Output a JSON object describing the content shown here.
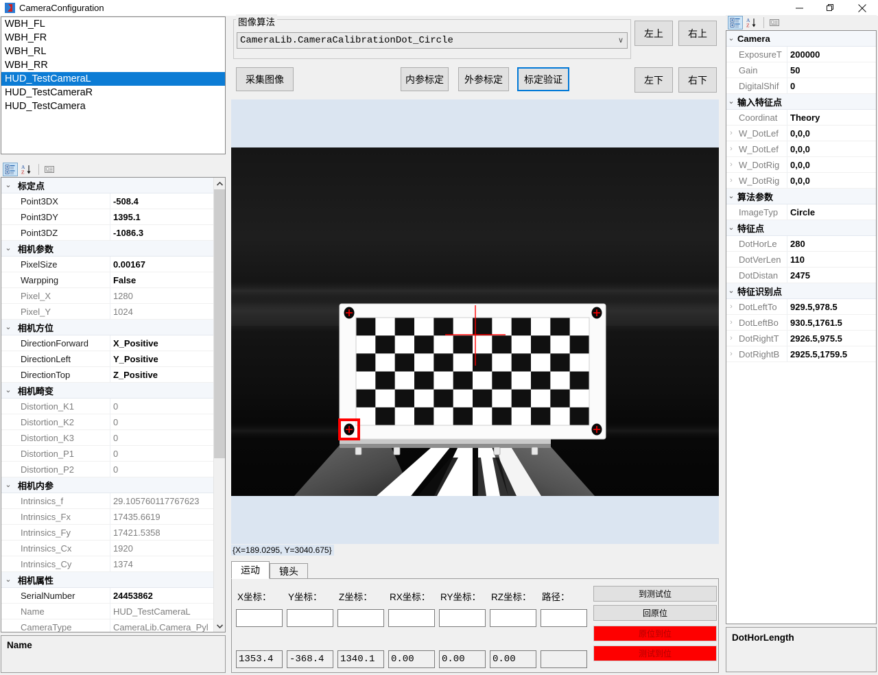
{
  "window": {
    "title": "CameraConfiguration",
    "icon": "app-icon",
    "minimize": "—",
    "maximize": "❐",
    "close": "✕"
  },
  "camera_list": {
    "items": [
      {
        "label": "WBH_FL",
        "selected": false
      },
      {
        "label": "WBH_FR",
        "selected": false
      },
      {
        "label": "WBH_RL",
        "selected": false
      },
      {
        "label": "WBH_RR",
        "selected": false
      },
      {
        "label": "HUD_TestCameraL",
        "selected": true
      },
      {
        "label": "HUD_TestCameraR",
        "selected": false
      },
      {
        "label": "HUD_TestCamera",
        "selected": false
      }
    ],
    "selection_color": "#0c7cd5"
  },
  "left_grid": {
    "toolbar": {
      "categorized": "categorized-view-icon",
      "alphabetical": "alphabetical-sort-icon",
      "property_pages": "property-pages-icon"
    },
    "rows": [
      {
        "kind": "category",
        "expander": "⌄",
        "name": "标定点",
        "value": ""
      },
      {
        "kind": "prop",
        "name": "Point3DX",
        "value": "-508.4",
        "bold": true,
        "name_dark": true
      },
      {
        "kind": "prop",
        "name": "Point3DY",
        "value": "1395.1",
        "bold": true,
        "name_dark": true
      },
      {
        "kind": "prop",
        "name": "Point3DZ",
        "value": "-1086.3",
        "bold": true,
        "name_dark": true
      },
      {
        "kind": "category",
        "expander": "⌄",
        "name": "相机参数",
        "value": ""
      },
      {
        "kind": "prop",
        "name": "PixelSize",
        "value": "0.00167",
        "bold": true,
        "name_dark": true
      },
      {
        "kind": "prop",
        "name": "Warpping",
        "value": "False",
        "bold": true,
        "name_dark": true
      },
      {
        "kind": "prop",
        "name": "Pixel_X",
        "value": "1280",
        "bold": false,
        "name_dark": false
      },
      {
        "kind": "prop",
        "name": "Pixel_Y",
        "value": "1024",
        "bold": false,
        "name_dark": false
      },
      {
        "kind": "category",
        "expander": "⌄",
        "name": "相机方位",
        "value": ""
      },
      {
        "kind": "prop",
        "name": "DirectionForward",
        "value": "X_Positive",
        "bold": true,
        "name_dark": true
      },
      {
        "kind": "prop",
        "name": "DirectionLeft",
        "value": "Y_Positive",
        "bold": true,
        "name_dark": true
      },
      {
        "kind": "prop",
        "name": "DirectionTop",
        "value": "Z_Positive",
        "bold": true,
        "name_dark": true
      },
      {
        "kind": "category",
        "expander": "⌄",
        "name": "相机畸变",
        "value": ""
      },
      {
        "kind": "prop",
        "name": "Distortion_K1",
        "value": "0",
        "bold": false,
        "name_dark": false
      },
      {
        "kind": "prop",
        "name": "Distortion_K2",
        "value": "0",
        "bold": false,
        "name_dark": false
      },
      {
        "kind": "prop",
        "name": "Distortion_K3",
        "value": "0",
        "bold": false,
        "name_dark": false
      },
      {
        "kind": "prop",
        "name": "Distortion_P1",
        "value": "0",
        "bold": false,
        "name_dark": false
      },
      {
        "kind": "prop",
        "name": "Distortion_P2",
        "value": "0",
        "bold": false,
        "name_dark": false
      },
      {
        "kind": "category",
        "expander": "⌄",
        "name": "相机内参",
        "value": ""
      },
      {
        "kind": "prop",
        "name": "Intrinsics_f",
        "value": "29.105760117767623",
        "bold": false,
        "name_dark": false
      },
      {
        "kind": "prop",
        "name": "Intrinsics_Fx",
        "value": "17435.6619",
        "bold": false,
        "name_dark": false
      },
      {
        "kind": "prop",
        "name": "Intrinsics_Fy",
        "value": "17421.5358",
        "bold": false,
        "name_dark": false
      },
      {
        "kind": "prop",
        "name": "Intrinsics_Cx",
        "value": "1920",
        "bold": false,
        "name_dark": false
      },
      {
        "kind": "prop",
        "name": "Intrinsics_Cy",
        "value": "1374",
        "bold": false,
        "name_dark": false
      },
      {
        "kind": "category",
        "expander": "⌄",
        "name": "相机属性",
        "value": ""
      },
      {
        "kind": "prop",
        "name": "SerialNumber",
        "value": "24453862",
        "bold": true,
        "name_dark": true
      },
      {
        "kind": "prop",
        "name": "Name",
        "value": "HUD_TestCameraL",
        "bold": false,
        "name_dark": false
      },
      {
        "kind": "prop",
        "name": "CameraType",
        "value": "CameraLib.Camera_Pyl",
        "bold": false,
        "name_dark": false
      }
    ],
    "description": {
      "title": "Name",
      "text": ""
    }
  },
  "algorithm": {
    "group_label": "图像算法",
    "combo_value": "CameraLib.CameraCalibrationDot_Circle",
    "combo_arrow": "∨"
  },
  "buttons": {
    "capture": "采集图像",
    "intrinsic": "内参标定",
    "extrinsic": "外参标定",
    "verify": "标定验证",
    "left_top": "左上",
    "right_top": "右上",
    "left_bottom": "左下",
    "right_bottom": "右下",
    "focus_accent": "#0078d7"
  },
  "viewer": {
    "coordinate_readout": "{X=189.0295, Y=3040.675}",
    "background": "#dbe5f1",
    "marker_color": "#ff0000",
    "checker_cols": 12,
    "checker_rows": 6
  },
  "bottom_tabs": {
    "tabs": [
      {
        "label": "运动",
        "active": true
      },
      {
        "label": "镜头",
        "active": false
      }
    ],
    "fields": [
      {
        "label": "X坐标：",
        "input": "",
        "readout": "1353.4"
      },
      {
        "label": "Y坐标：",
        "input": "",
        "readout": "-368.4"
      },
      {
        "label": "Z坐标：",
        "input": "",
        "readout": "1340.1"
      },
      {
        "label": "RX坐标：",
        "input": "",
        "readout": "0.00"
      },
      {
        "label": "RY坐标：",
        "input": "",
        "readout": "0.00"
      },
      {
        "label": "RZ坐标：",
        "input": "",
        "readout": "0.00"
      },
      {
        "label": "路径：",
        "input": "",
        "readout": ""
      }
    ],
    "actions": [
      {
        "label": "到测试位",
        "style": "normal"
      },
      {
        "label": "回原位",
        "style": "normal"
      },
      {
        "label": "原位到位",
        "style": "red"
      },
      {
        "label": "测试到位",
        "style": "red"
      }
    ],
    "red_color": "#fe0000"
  },
  "right_grid": {
    "toolbar": {
      "categorized": "categorized-view-icon",
      "alphabetical": "alphabetical-sort-icon",
      "property_pages": "property-pages-icon"
    },
    "rows": [
      {
        "kind": "category",
        "expander": "⌄",
        "name": "Camera",
        "value": ""
      },
      {
        "kind": "prop",
        "name": "ExposureT",
        "value": "200000",
        "bold": true
      },
      {
        "kind": "prop",
        "name": "Gain",
        "value": "50",
        "bold": true
      },
      {
        "kind": "prop",
        "name": "DigitalShif",
        "value": "0",
        "bold": true
      },
      {
        "kind": "category",
        "expander": "⌄",
        "name": "输入特征点",
        "value": ""
      },
      {
        "kind": "prop",
        "name": "Coordinat",
        "value": "Theory",
        "bold": true
      },
      {
        "kind": "prop",
        "expander": "›",
        "name": "W_DotLef",
        "value": "0,0,0",
        "bold": true
      },
      {
        "kind": "prop",
        "expander": "›",
        "name": "W_DotLef",
        "value": "0,0,0",
        "bold": true
      },
      {
        "kind": "prop",
        "expander": "›",
        "name": "W_DotRig",
        "value": "0,0,0",
        "bold": true
      },
      {
        "kind": "prop",
        "expander": "›",
        "name": "W_DotRig",
        "value": "0,0,0",
        "bold": true
      },
      {
        "kind": "category",
        "expander": "⌄",
        "name": "算法参数",
        "value": ""
      },
      {
        "kind": "prop",
        "name": "ImageTyp",
        "value": "Circle",
        "bold": true
      },
      {
        "kind": "category",
        "expander": "⌄",
        "name": "特征点",
        "value": ""
      },
      {
        "kind": "prop",
        "name": "DotHorLe",
        "value": "280",
        "bold": true
      },
      {
        "kind": "prop",
        "name": "DotVerLen",
        "value": "110",
        "bold": true
      },
      {
        "kind": "prop",
        "name": "DotDistan",
        "value": "2475",
        "bold": true
      },
      {
        "kind": "category",
        "expander": "⌄",
        "name": "特征识别点",
        "value": ""
      },
      {
        "kind": "prop",
        "expander": "›",
        "name": "DotLeftTo",
        "value": "929.5,978.5",
        "bold": true
      },
      {
        "kind": "prop",
        "expander": "›",
        "name": "DotLeftBo",
        "value": "930.5,1761.5",
        "bold": true
      },
      {
        "kind": "prop",
        "expander": "›",
        "name": "DotRightT",
        "value": "2926.5,975.5",
        "bold": true
      },
      {
        "kind": "prop",
        "expander": "›",
        "name": "DotRightB",
        "value": "2925.5,1759.5",
        "bold": true
      }
    ],
    "description": {
      "title": "DotHorLength",
      "text": ""
    }
  }
}
